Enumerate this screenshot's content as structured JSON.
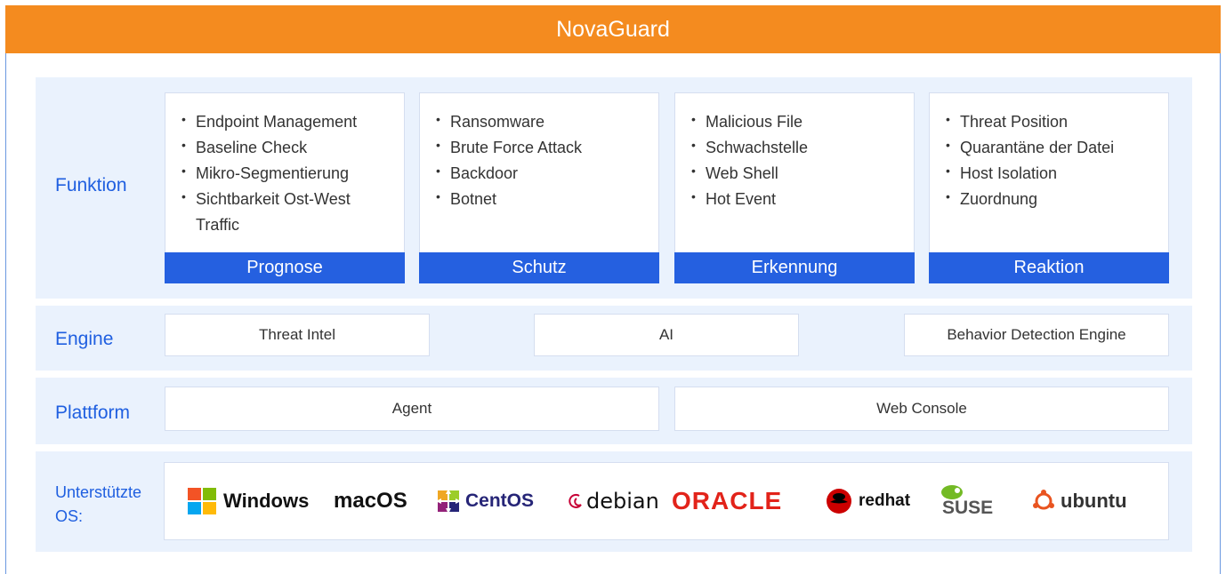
{
  "title": "NovaGuard",
  "rows": {
    "funktion": "Funktion",
    "engine": "Engine",
    "plattform": "Plattform",
    "os": "Unterstützte OS:"
  },
  "functions": [
    {
      "title": "Prognose",
      "items": [
        "Endpoint Management",
        "Baseline Check",
        "Mikro-Segmentierung",
        "Sichtbarkeit Ost-West Traffic"
      ]
    },
    {
      "title": "Schutz",
      "items": [
        "Ransomware",
        "Brute Force Attack",
        "Backdoor",
        "Botnet"
      ]
    },
    {
      "title": "Erkennung",
      "items": [
        "Malicious File",
        "Schwachstelle",
        "Web Shell",
        "Hot Event"
      ]
    },
    {
      "title": "Reaktion",
      "items": [
        "Threat Position",
        "Quarantäne der Datei",
        "Host Isolation",
        "Zuordnung"
      ]
    }
  ],
  "engines": [
    "Threat Intel",
    "AI",
    "Behavior Detection Engine"
  ],
  "platforms": [
    "Agent",
    "Web Console"
  ],
  "os_list": [
    "Windows",
    "macOS",
    "CentOS",
    "debian",
    "ORACLE",
    "redhat",
    "SUSE",
    "ubuntu"
  ],
  "colors": {
    "banner": "#f48b1f",
    "accent": "#2560e0",
    "label": "#1f5fe0",
    "band": "#eaf2fd"
  }
}
